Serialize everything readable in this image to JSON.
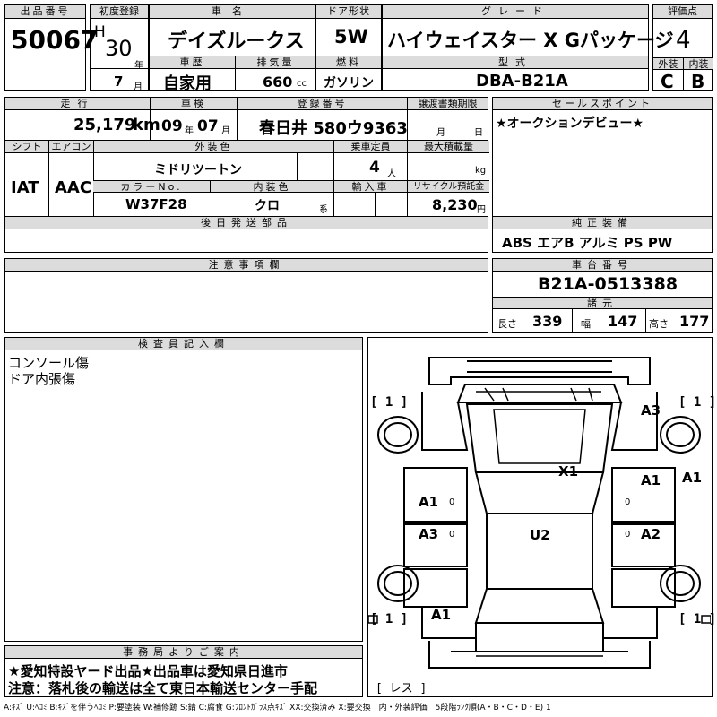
{
  "auction": {
    "label": "出品番号",
    "value": "50067"
  },
  "first_reg": {
    "label": "初度登録",
    "era": "H",
    "year": "30",
    "year_unit": "年",
    "month": "7",
    "month_unit": "月"
  },
  "car_name": {
    "label": "車名",
    "value": "デイズルークス"
  },
  "door": {
    "label": "ドア形状",
    "value": "5W"
  },
  "grade": {
    "label": "グレード",
    "value": "ハイウェイスター X Gパッケージ"
  },
  "score": {
    "label": "評価点",
    "value": "4",
    "ext_label": "外装",
    "int_label": "内装",
    "ext": "C",
    "int": "B"
  },
  "history": {
    "label": "車歴",
    "value": "自家用"
  },
  "displacement": {
    "label": "排気量",
    "value": "660",
    "unit": "cc"
  },
  "fuel": {
    "label": "燃料",
    "value": "ガソリン"
  },
  "model": {
    "label": "型式",
    "value": "DBA-B21A"
  },
  "mileage": {
    "label": "走行",
    "value": "25,179",
    "unit": "km"
  },
  "inspection": {
    "label": "車検",
    "year": "09",
    "year_unit": "年",
    "month": "07",
    "month_unit": "月"
  },
  "registration": {
    "label": "登録番号",
    "value": "春日井 580ウ9363"
  },
  "transfer": {
    "label": "譲渡書類期限",
    "month_unit": "月",
    "day_unit": "日"
  },
  "sales_point": {
    "label": "セールスポイント",
    "text": "★オークションデビュー★"
  },
  "shift": {
    "label": "シフト",
    "value": "IAT"
  },
  "aircon": {
    "label": "エアコン",
    "value": "AAC"
  },
  "ext_color": {
    "label": "外装色",
    "value": "ミドリツートン"
  },
  "capacity": {
    "label": "乗車定員",
    "value": "4",
    "unit": "人"
  },
  "max_load": {
    "label": "最大積載量",
    "unit": "kg"
  },
  "color_no": {
    "label": "カラーNo.",
    "value": "W37F28"
  },
  "int_color": {
    "label": "内装色",
    "value": "クロ",
    "unit": "系"
  },
  "import": {
    "label": "輸入車"
  },
  "recycle": {
    "label": "リサイクル預託金",
    "value": "8,230",
    "unit": "円"
  },
  "later_parts": {
    "label": "後日発送部品"
  },
  "equipment": {
    "label": "純正装備",
    "value": "ABS エアB アルミ PS PW"
  },
  "notes": {
    "label": "注意事項欄"
  },
  "chassis": {
    "label": "車台番号",
    "value": "B21A-0513388",
    "dims_label": "諸元",
    "length_label": "長さ",
    "length": "339",
    "width_label": "幅",
    "width": "147",
    "height_label": "高さ",
    "height": "177"
  },
  "inspector": {
    "label": "検査員記入欄",
    "lines": [
      "コンソール傷",
      "ドア内張傷"
    ]
  },
  "office": {
    "label": "事務局よりご案内",
    "lines": [
      "★愛知特設ヤード出品★出品車は愛知県日進市",
      "注意：落札後の輸送は全て東日本輸送センター手配"
    ]
  },
  "diagram": {
    "marks": [
      "A3",
      "X1",
      "A1",
      "A1",
      "A1",
      "A3",
      "U2",
      "A2",
      "A1"
    ],
    "bracket_one": "[ 1 ]",
    "bracket_less": "[ レス ]",
    "zero": "0"
  },
  "legend": "A:ｷｽﾞ U:ﾍｺﾐ B:ｷｽﾞを伴うﾍｺﾐ P:要塗装 W:補修跡 S:錆 C:腐食 G:ﾌﾛﾝﾄｶﾞﾗｽ点ｷｽﾞ XX:交換済み X:要交換　内・外装評価　5段階ﾗﾝｸ順(A・B・C・D・E) 1"
}
